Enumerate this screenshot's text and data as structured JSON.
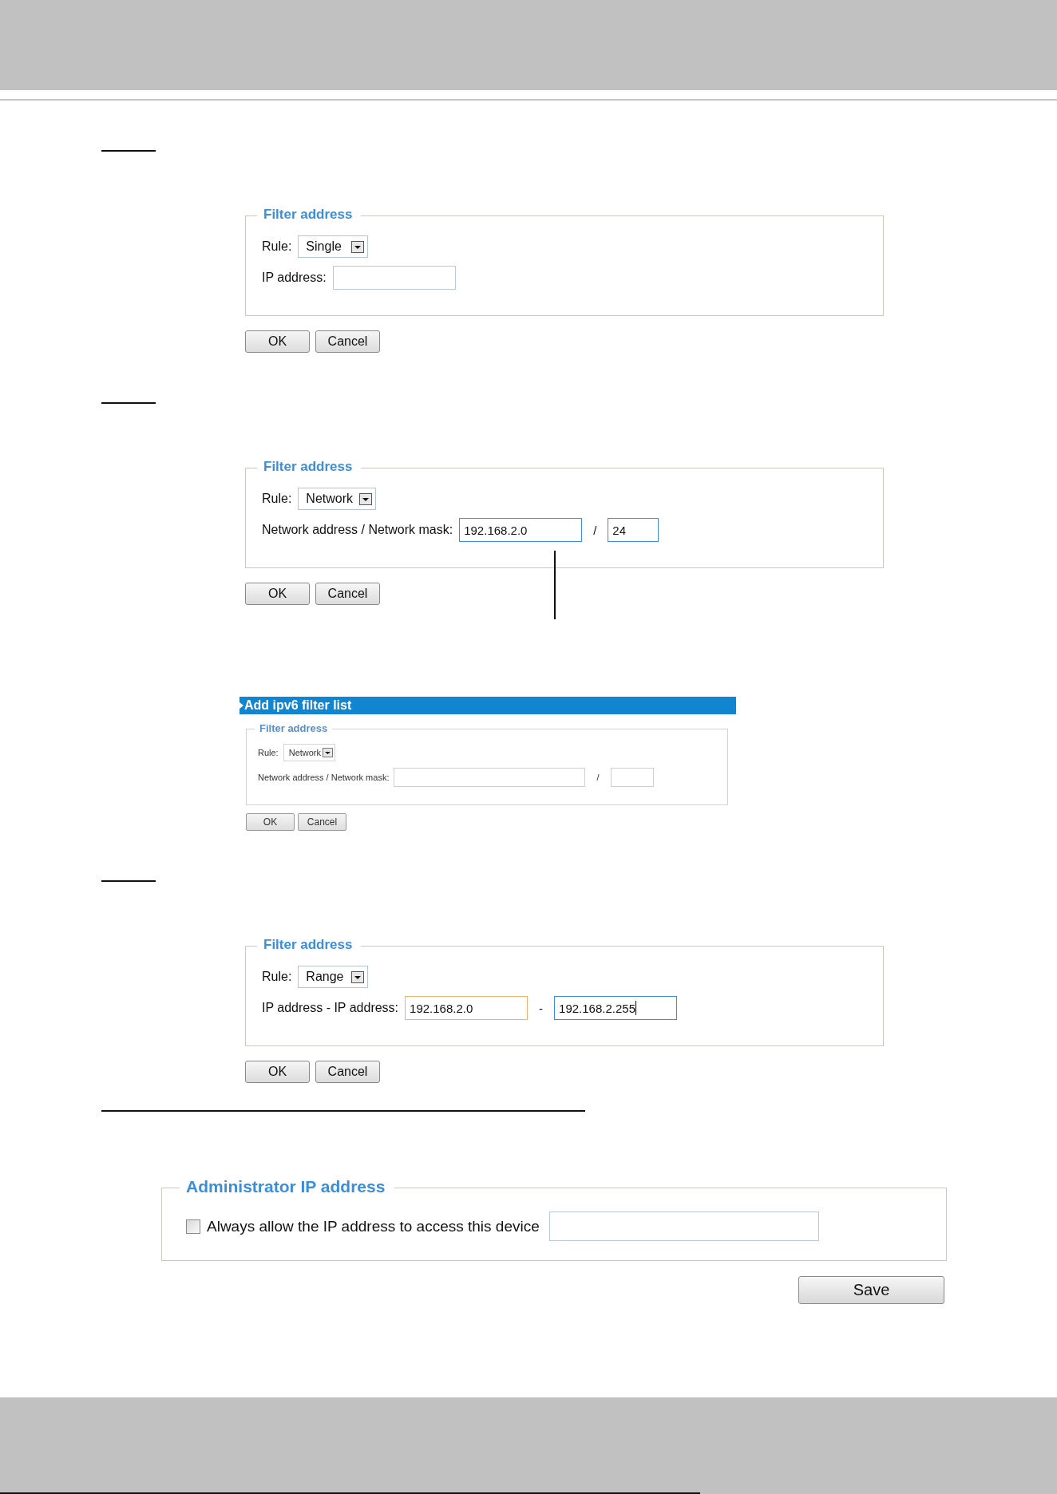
{
  "sections": [
    {
      "kind": "filter",
      "legend": "Filter address",
      "rule_label": "Rule:",
      "rule_value": "Single",
      "row_label": "IP address:",
      "fields": [
        {
          "kind": "address",
          "highlighted": false,
          "focused": false,
          "cursor": false
        }
      ],
      "buttons": [
        "OK",
        "Cancel"
      ]
    },
    {
      "kind": "filter",
      "legend": "Filter address",
      "rule_label": "Rule:",
      "rule_value": "Network",
      "leader_line": true,
      "row_label": "Network address / Network mask:",
      "fields": [
        {
          "kind": "address",
          "value": "192.168.2.0",
          "highlighted": false,
          "focused": true,
          "cursor": false
        },
        {
          "kind": "mask",
          "value": "24",
          "highlighted": false,
          "focused": true,
          "cursor": false
        }
      ],
      "separator": "/",
      "buttons": [
        "OK",
        "Cancel"
      ]
    },
    {
      "kind": "ipv6",
      "title": "Add ipv6 filter list",
      "legend": "Filter address",
      "rule_label": "Rule:",
      "rule_value": "Network",
      "row_label": "Network address / Network mask:",
      "separator": "/",
      "buttons": [
        "OK",
        "Cancel"
      ]
    },
    {
      "kind": "filter",
      "legend": "Filter address",
      "rule_label": "Rule:",
      "rule_value": "Range",
      "row_label": "IP address - IP address:",
      "fields": [
        {
          "kind": "address",
          "value": "192.168.2.0",
          "highlighted": true,
          "focused": false,
          "cursor": false
        },
        {
          "kind": "address",
          "value": "192.168.2.255",
          "highlighted": false,
          "focused": true,
          "cursor": true
        }
      ],
      "separator": "-",
      "buttons": [
        "OK",
        "Cancel"
      ]
    },
    {
      "kind": "admin",
      "legend": "Administrator IP address",
      "checkbox_label": "Always allow the IP address to access this device",
      "checked": false,
      "save": "Save"
    }
  ]
}
